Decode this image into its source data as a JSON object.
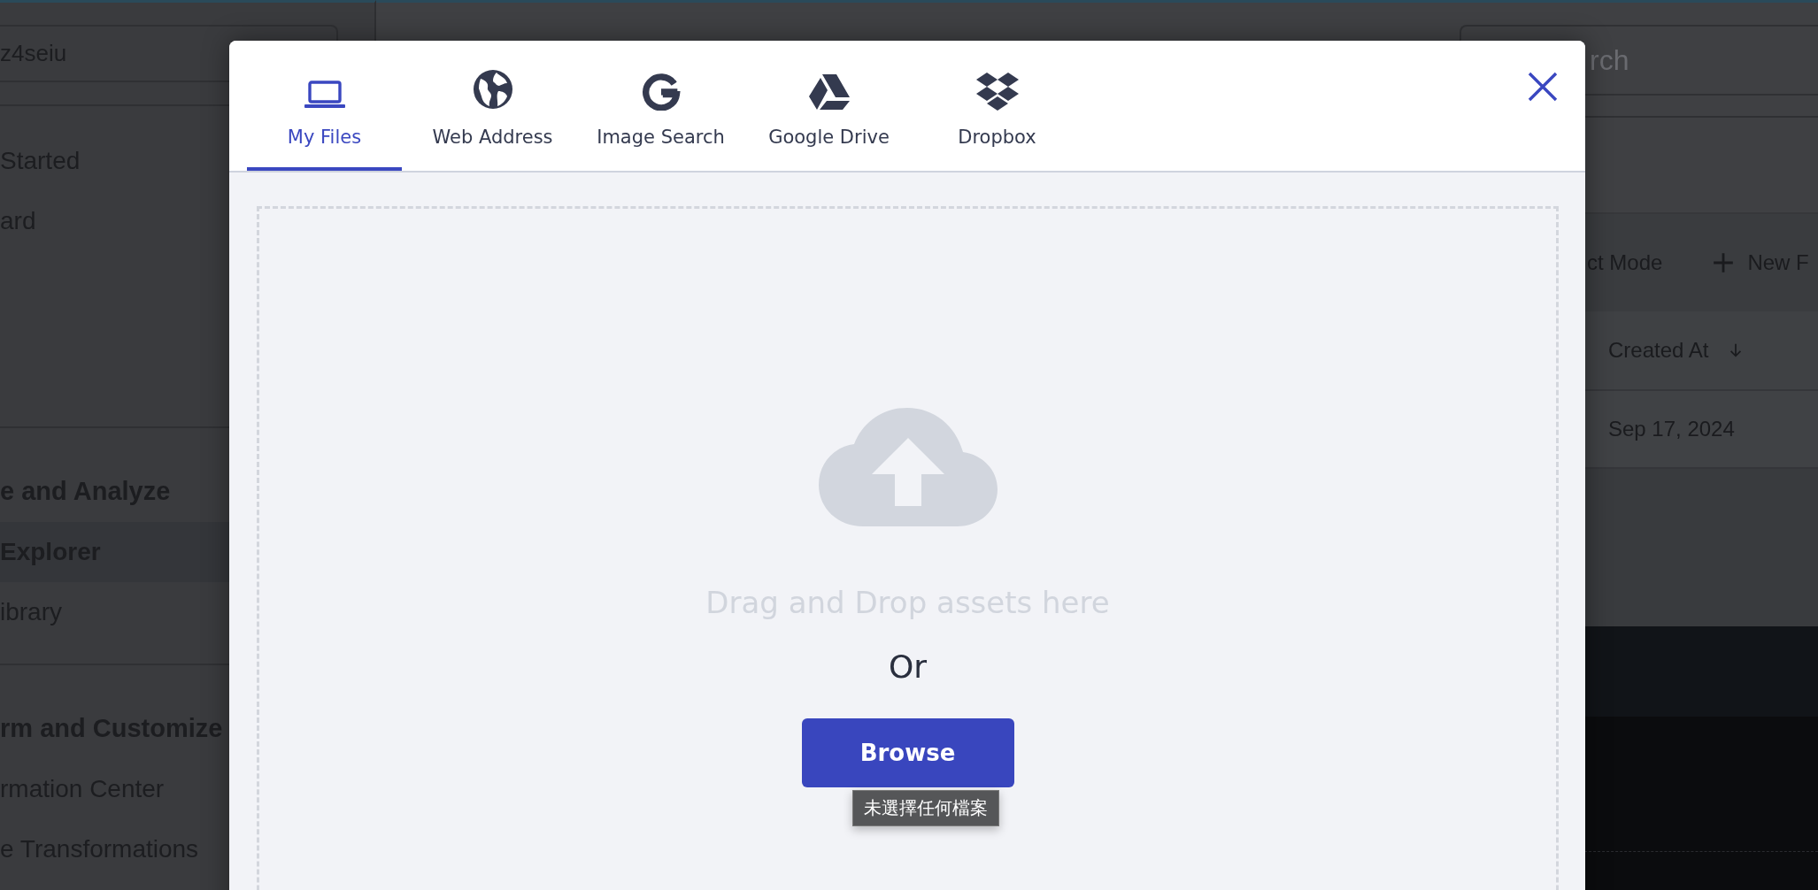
{
  "sidebar": {
    "search_value": "z4seiu",
    "sections": [
      {
        "items": [
          {
            "label": "Started",
            "selected": false
          },
          {
            "label": "ard",
            "selected": false
          }
        ]
      },
      {
        "heading": "e and Analyze",
        "items": [
          {
            "label": "Explorer",
            "selected": true
          },
          {
            "label": "ibrary",
            "selected": false
          }
        ]
      },
      {
        "heading": "rm and Customize",
        "items": [
          {
            "label": "rmation Center",
            "selected": false
          },
          {
            "label": "e Transformations",
            "selected": false
          }
        ]
      }
    ]
  },
  "main": {
    "search_placeholder": "rch",
    "toolbar": [
      "ct Mode",
      "New F"
    ],
    "table": {
      "columns": [
        {
          "label": "Created At",
          "sort_descending": true
        }
      ],
      "rows": [
        [
          "Sep 17, 2024"
        ]
      ]
    }
  },
  "modal": {
    "tabs": [
      {
        "label": "My Files",
        "kind": "laptop",
        "selected": true
      },
      {
        "label": "Web Address",
        "kind": "globe",
        "selected": false
      },
      {
        "label": "Image Search",
        "kind": "google",
        "selected": false
      },
      {
        "label": "Google Drive",
        "kind": "drive",
        "selected": false
      },
      {
        "label": "Dropbox",
        "kind": "dropbox",
        "selected": false
      }
    ],
    "drop_text": "Drag and Drop assets here",
    "or_text": "Or",
    "button": "Browse",
    "tooltip": "未選擇任何檔案"
  }
}
